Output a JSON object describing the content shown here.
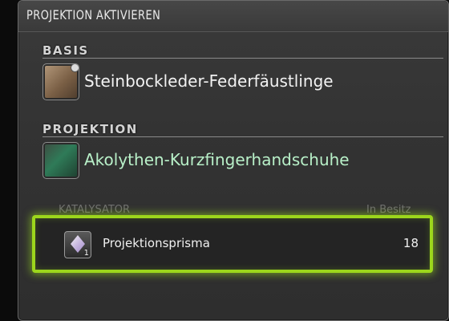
{
  "window": {
    "title": "PROJEKTION AKTIVIEREN"
  },
  "base": {
    "label": "BASIS",
    "item_name": "Steinbockleder-Federfäustlinge",
    "icon": "leather-gloves-icon"
  },
  "projection": {
    "label": "PROJEKTION",
    "item_name": "Akolythen-Kurzfingerhandschuhe",
    "icon": "fingerless-gloves-icon"
  },
  "catalyst": {
    "column_header": "KATALYSATOR",
    "owned_header": "In Besitz",
    "item_name": "Projektionsprisma",
    "icon": "prism-icon",
    "icon_quantity": "1",
    "owned_count": "18",
    "highlight_color": "#9cd61c"
  }
}
